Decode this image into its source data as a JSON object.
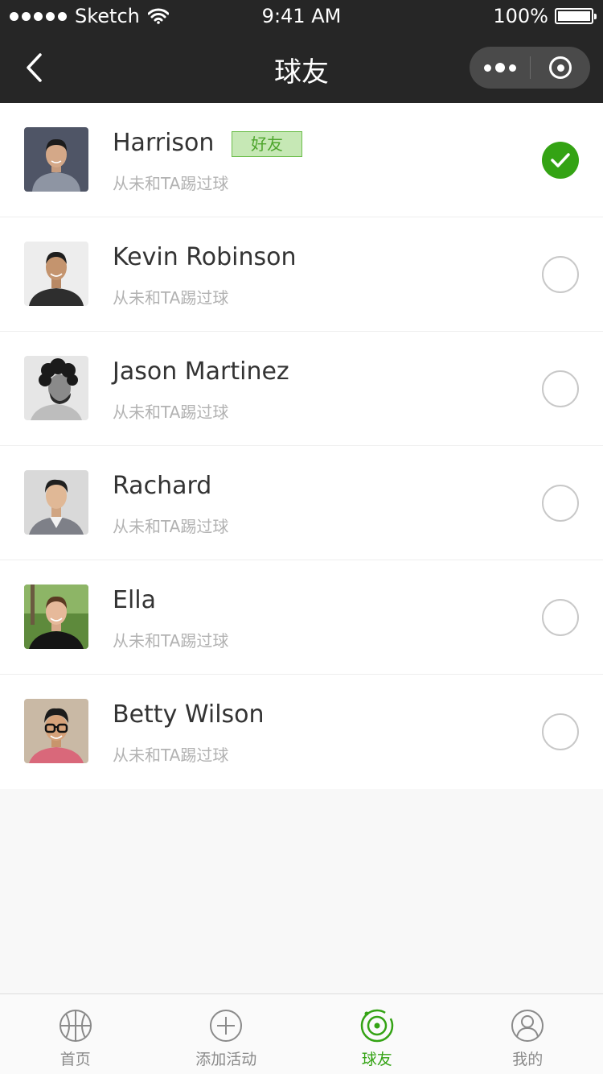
{
  "status_bar": {
    "carrier": "Sketch",
    "time": "9:41 AM",
    "battery": "100%"
  },
  "nav": {
    "title": "球友"
  },
  "friends": [
    {
      "name": "Harrison",
      "tag": "好友",
      "subtitle": "从未和TA踢过球",
      "selected": true
    },
    {
      "name": "Kevin Robinson",
      "tag": "",
      "subtitle": "从未和TA踢过球",
      "selected": false
    },
    {
      "name": "Jason Martinez",
      "tag": "",
      "subtitle": "从未和TA踢过球",
      "selected": false
    },
    {
      "name": "Rachard",
      "tag": "",
      "subtitle": "从未和TA踢过球",
      "selected": false
    },
    {
      "name": "Ella",
      "tag": "",
      "subtitle": "从未和TA踢过球",
      "selected": false
    },
    {
      "name": "Betty Wilson",
      "tag": "",
      "subtitle": "从未和TA踢过球",
      "selected": false
    }
  ],
  "tabbar": {
    "items": [
      {
        "label": "首页",
        "icon": "basketball-icon",
        "active": false
      },
      {
        "label": "添加活动",
        "icon": "plus-circle-icon",
        "active": false
      },
      {
        "label": "球友",
        "icon": "target-icon",
        "active": true
      },
      {
        "label": "我的",
        "icon": "user-icon",
        "active": false
      }
    ]
  },
  "colors": {
    "accent": "#34a314",
    "nav_bg": "#262626",
    "tag_bg": "#c6e8b5"
  }
}
